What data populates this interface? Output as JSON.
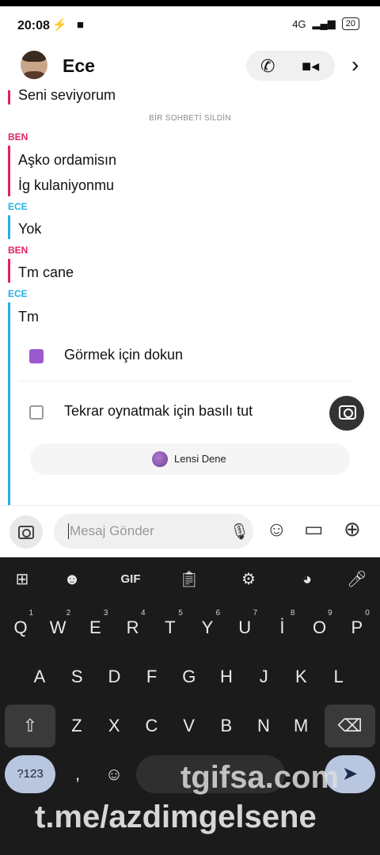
{
  "status_bar": {
    "time": "20:08",
    "left_icons": "⚡ ■",
    "network": "4G",
    "battery": "20"
  },
  "header": {
    "contact_name": "Ece"
  },
  "chat": {
    "partial_top_message": "Seni seviyorum",
    "system_notice": "BİR SOHBETİ SİLDİN",
    "groups": [
      {
        "sender": "BEN",
        "messages": [
          "Aşko ordamisın",
          "İg kulaniyonmu"
        ]
      },
      {
        "sender": "ECE",
        "messages": [
          "Yok"
        ]
      },
      {
        "sender": "BEN",
        "messages": [
          "Tm cane"
        ]
      },
      {
        "sender": "ECE",
        "messages": [
          "Tm"
        ]
      }
    ],
    "snap_view": "Görmek için dokun",
    "snap_replay": "Tekrar oynatmak için basılı tut",
    "lens_label": "Lensi Dene"
  },
  "input": {
    "placeholder": "Mesaj Gönder"
  },
  "keyboard": {
    "toolbar": [
      "grid-icon",
      "sticker-icon",
      "GIF",
      "clipboard-icon",
      "settings-icon",
      "palette-icon",
      "mic-icon"
    ],
    "gif_label": "GIF",
    "row1": [
      {
        "k": "Q",
        "n": "1"
      },
      {
        "k": "W",
        "n": "2"
      },
      {
        "k": "E",
        "n": "3"
      },
      {
        "k": "R",
        "n": "4"
      },
      {
        "k": "T",
        "n": "5"
      },
      {
        "k": "Y",
        "n": "6"
      },
      {
        "k": "U",
        "n": "7"
      },
      {
        "k": "İ",
        "n": "8"
      },
      {
        "k": "O",
        "n": "9"
      },
      {
        "k": "P",
        "n": "0"
      }
    ],
    "row2": [
      "A",
      "S",
      "D",
      "F",
      "G",
      "H",
      "J",
      "K",
      "L"
    ],
    "row3": [
      "Z",
      "X",
      "C",
      "V",
      "B",
      "N",
      "M"
    ],
    "sym_label": "?123",
    "comma": ","
  },
  "watermarks": {
    "line1": "tgifsa.com",
    "line2": "t.me/azdimgelsene"
  }
}
